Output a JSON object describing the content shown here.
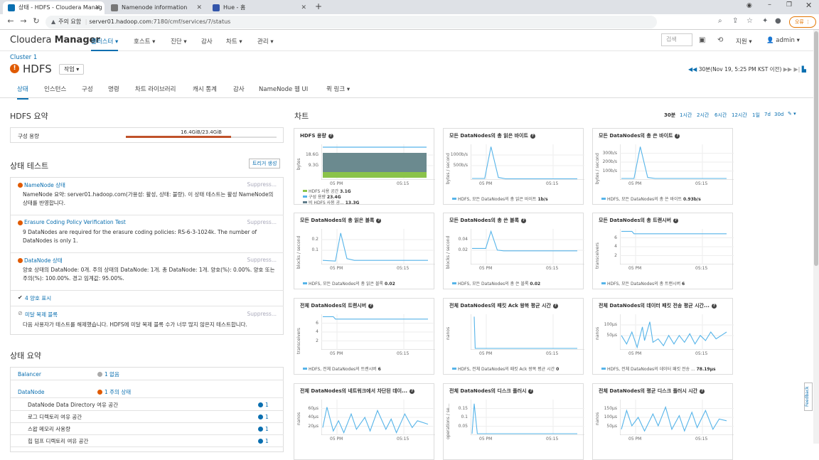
{
  "browser": {
    "tabs": [
      {
        "title": "상태 - HDFS - Cloudera Manag",
        "active": true,
        "favicon_color": "#0a6fb0"
      },
      {
        "title": "Namenode information",
        "active": false,
        "favicon_color": "#777777"
      },
      {
        "title": "Hue - 홈",
        "active": false,
        "favicon_color": "#3355aa"
      }
    ],
    "new_tab": "+",
    "warning": "주의 요함",
    "url_host": "server01.hadoop.com",
    "url_path": ":7180/cmf/services/7/status",
    "update_label": "오류 ⋮"
  },
  "header": {
    "logo_light": "Cloudera",
    "logo_bold": "Manager",
    "nav": [
      "클러스터 ▾",
      "호스트 ▾",
      "진단 ▾",
      "감사",
      "차트 ▾",
      "관리 ▾"
    ],
    "search_placeholder": "검색",
    "support": "지원 ▾",
    "user": "admin ▾"
  },
  "service": {
    "cluster": "Cluster 1",
    "name": "HDFS",
    "actions": "작업 ▾",
    "time_range": "30분(Nov 19, 5:25 PM KST 이전)"
  },
  "subtabs": [
    "상태",
    "인스턴스",
    "구성",
    "명령",
    "차트 라이브러리",
    "캐시 통계",
    "감사",
    "NameNode 웹 UI",
    "퀵 링크 ▾"
  ],
  "summary": {
    "title": "HDFS 요약",
    "capacity_label": "구성 용량",
    "capacity_value": "16.4GiB/23.4GiB",
    "capacity_fraction": 0.7
  },
  "health_tests": {
    "title": "상태 테스트",
    "trigger": "트리거 생성",
    "tests": [
      {
        "title": "NameNode 상태",
        "status": "red",
        "suppress": "Suppress...",
        "desc": "NameNode 요약: server01.hadoop.com(가용성: 활성, 상태: 불량). 이 상태 테스트는 활성 NameNode의 상태를 반영합니다."
      },
      {
        "title": "Erasure Coding Policy Verification Test",
        "status": "orange",
        "suppress": "Suppress...",
        "desc": "9 DataNodes are required for the erasure coding policies: RS-6-3-1024k. The number of DataNodes is only 1."
      },
      {
        "title": "DataNode 상태",
        "status": "orange",
        "suppress": "Suppress...",
        "desc": "양호 상태의 DataNode: 0개. 주의 상태의 DataNode: 1개. 총 DataNode: 1개. 양호(%): 0.00%. 양호 또는 주의(%): 100.00%. 경고 임계값: 95.00%."
      }
    ],
    "good_label": "4 양호 표시",
    "disabled_title": "미달 복제 블록",
    "disabled_suppress": "Suppress...",
    "disabled_desc": "다음 사용자가 테스트를 해제했습니다. HDFS에 미달 복제 블록 수가 너무 많지 않은지 테스트합니다."
  },
  "health_summary": {
    "title": "상태 요약",
    "rows": [
      {
        "name": "Balancer",
        "status": "1 없음",
        "dot": "#aaaaaa",
        "link": true,
        "indent": false
      },
      {
        "name": "DataNode",
        "status": "1 주의 상태",
        "dot": "#e05a00",
        "link": true,
        "indent": false
      },
      {
        "name": "DataNode Data Directory 여유 공간",
        "status": "1",
        "dot": "#0a6fb0",
        "link": false,
        "indent": true
      },
      {
        "name": "로그 디렉토리 여유 공간",
        "status": "1",
        "dot": "#0a6fb0",
        "link": false,
        "indent": true
      },
      {
        "name": "스왑 메모리 사용량",
        "status": "1",
        "dot": "#0a6fb0",
        "link": false,
        "indent": true
      },
      {
        "name": "힙 덤프 디렉토리 여유 공간",
        "status": "1",
        "dot": "#0a6fb0",
        "link": false,
        "indent": true
      }
    ]
  },
  "charts_header": {
    "title": "차트",
    "ranges": [
      "30분",
      "1시간",
      "2시간",
      "6시간",
      "12시간",
      "1일",
      "7d",
      "30d"
    ],
    "active_range": "30분",
    "edit": "✎ ▾"
  },
  "charts": [
    {
      "title": "HDFS 용량",
      "ylabel": "bytes",
      "yticks": [
        "18.6G",
        "9.3G"
      ],
      "xticks": [
        "05 PM",
        "05:15"
      ],
      "legend": [
        [
          "HDFS 사용 공간",
          "3.1G",
          "#8bc34a"
        ],
        [
          "구성 용량",
          "23.4G",
          "#56b4e9"
        ],
        [
          "비 HDFS 사용 공...",
          "13.3G",
          "#607d8b"
        ]
      ]
    },
    {
      "title": "모든 DataNodes의 총 읽은 바이트",
      "ylabel": "bytes / second",
      "yticks": [
        "1000b/s",
        "500b/s"
      ],
      "xticks": [
        "05 PM",
        "05:15"
      ],
      "legend": [
        [
          "HDFS, 모든 DataNodes의 총 읽은 바이트",
          "1b/s",
          "#56b4e9"
        ]
      ]
    },
    {
      "title": "모든 DataNodes의 총 쓴 바이트",
      "ylabel": "bytes / second",
      "yticks": [
        "300b/s",
        "200b/s",
        "100b/s"
      ],
      "xticks": [
        "05 PM",
        "05:15"
      ],
      "legend": [
        [
          "HDFS, 모든 DataNodes의 총 쓴 바이트",
          "0.93b/s",
          "#56b4e9"
        ]
      ]
    },
    {
      "title": "모든 DataNodes의 총 읽은 블록",
      "ylabel": "blocks / second",
      "yticks": [
        "0.2",
        "0.1"
      ],
      "xticks": [
        "05 PM",
        "05:15"
      ],
      "legend": [
        [
          "HDFS, 모든 DataNodes의 총 읽은 블록",
          "0.02",
          "#56b4e9"
        ]
      ]
    },
    {
      "title": "모든 DataNodes의 총 쓴 블록",
      "ylabel": "blocks / second",
      "yticks": [
        "0.04",
        "0.02"
      ],
      "xticks": [
        "05 PM",
        "05:15"
      ],
      "legend": [
        [
          "HDFS, 모든 DataNodes의 총 쓴 블록",
          "0.02",
          "#56b4e9"
        ]
      ]
    },
    {
      "title": "모든 DataNodes의 총 트랜시버",
      "ylabel": "transceivers",
      "yticks": [
        "6",
        "4",
        "2"
      ],
      "xticks": [
        "05 PM",
        "05:15"
      ],
      "legend": [
        [
          "HDFS, 모든 DataNodes의 총 트랜시버",
          "6",
          "#56b4e9"
        ]
      ]
    },
    {
      "title": "전체 DataNodes의 트랜시버",
      "ylabel": "transceivers",
      "yticks": [
        "6",
        "4",
        "2"
      ],
      "xticks": [
        "05 PM",
        "05:15"
      ],
      "legend": [
        [
          "HDFS, 전체 DataNodes의 트랜시버",
          "6",
          "#56b4e9"
        ]
      ]
    },
    {
      "title": "전체 DataNodes의 패킷 Ack 왕복 평균 시간",
      "ylabel": "nanos",
      "yticks": [],
      "xticks": [
        "05 PM",
        "05:15"
      ],
      "legend": [
        [
          "HDFS, 전체 DataNodes의 패킷 Ack 왕복 평균 시간",
          "0",
          "#56b4e9"
        ]
      ]
    },
    {
      "title": "전체 DataNodes의 데이터 패킷 전송 평균 시간...",
      "ylabel": "nanos",
      "yticks": [
        "100µs",
        "50µs"
      ],
      "xticks": [
        "05 PM",
        "05:15"
      ],
      "legend": [
        [
          "HDFS, 전체 DataNodes의 데이터 패킷 전송 ...",
          "78.19µs",
          "#56b4e9"
        ]
      ]
    },
    {
      "title": "전체 DataNodes의 네트워크에서 차단된 데이...",
      "ylabel": "nanos",
      "yticks": [
        "60µs",
        "40µs",
        "20µs"
      ],
      "xticks": [
        "05 PM",
        "05:15"
      ],
      "legend": []
    },
    {
      "title": "전체 DataNodes의 디스크 플러시",
      "ylabel": "operations / se...",
      "yticks": [
        "0.15",
        "0.1",
        "0.05"
      ],
      "xticks": [
        "05 PM",
        "05:15"
      ],
      "legend": []
    },
    {
      "title": "전체 DataNodes의 평균 디스크 플러시 시간",
      "ylabel": "nanos",
      "yticks": [
        "150µs",
        "100µs",
        "50µs"
      ],
      "xticks": [
        "05 PM",
        "05:15"
      ],
      "legend": []
    }
  ],
  "feedback": "Feedback"
}
